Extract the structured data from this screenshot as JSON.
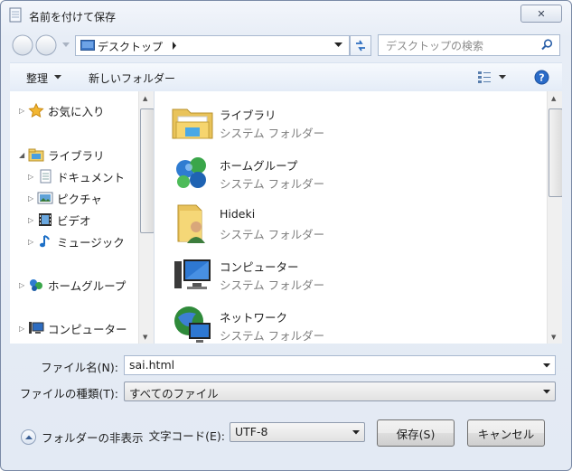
{
  "window": {
    "title": "名前を付けて保存",
    "close_label": "✕"
  },
  "address": {
    "location": "デスクトップ"
  },
  "search": {
    "placeholder": "デスクトップの検索"
  },
  "toolbar": {
    "organize_label": "整理",
    "new_folder_label": "新しいフォルダー"
  },
  "nav": {
    "items": [
      {
        "label": "お気に入り",
        "icon": "star-icon"
      },
      {
        "label": "ライブラリ",
        "icon": "library-icon"
      },
      {
        "label": "ドキュメント",
        "icon": "document-icon"
      },
      {
        "label": "ピクチャ",
        "icon": "picture-icon"
      },
      {
        "label": "ビデオ",
        "icon": "video-icon"
      },
      {
        "label": "ミュージック",
        "icon": "music-icon"
      },
      {
        "label": "ホームグループ",
        "icon": "homegroup-icon"
      },
      {
        "label": "コンピューター",
        "icon": "computer-icon"
      }
    ]
  },
  "content": {
    "items": [
      {
        "name": "ライブラリ",
        "type": "システム フォルダー",
        "icon": "library-folder-icon"
      },
      {
        "name": "ホームグループ",
        "type": "システム フォルダー",
        "icon": "homegroup-icon"
      },
      {
        "name": "Hideki",
        "type": "システム フォルダー",
        "icon": "user-folder-icon"
      },
      {
        "name": "コンピューター",
        "type": "システム フォルダー",
        "icon": "computer-icon"
      },
      {
        "name": "ネットワーク",
        "type": "システム フォルダー",
        "icon": "network-icon"
      }
    ]
  },
  "form": {
    "filename_label": "ファイル名(N):",
    "filename_value": "sai.html",
    "filetype_label": "ファイルの種類(T):",
    "filetype_value": "すべてのファイル",
    "hide_folders_label": "フォルダーの非表示",
    "encoding_label": "文字コード(E):",
    "encoding_value": "UTF-8",
    "save_label": "保存(S)",
    "cancel_label": "キャンセル"
  },
  "colors": {
    "accent": "#1f5fbf",
    "frame": "#7a8aa6",
    "toolbar_bg": "#e4ecf7"
  }
}
